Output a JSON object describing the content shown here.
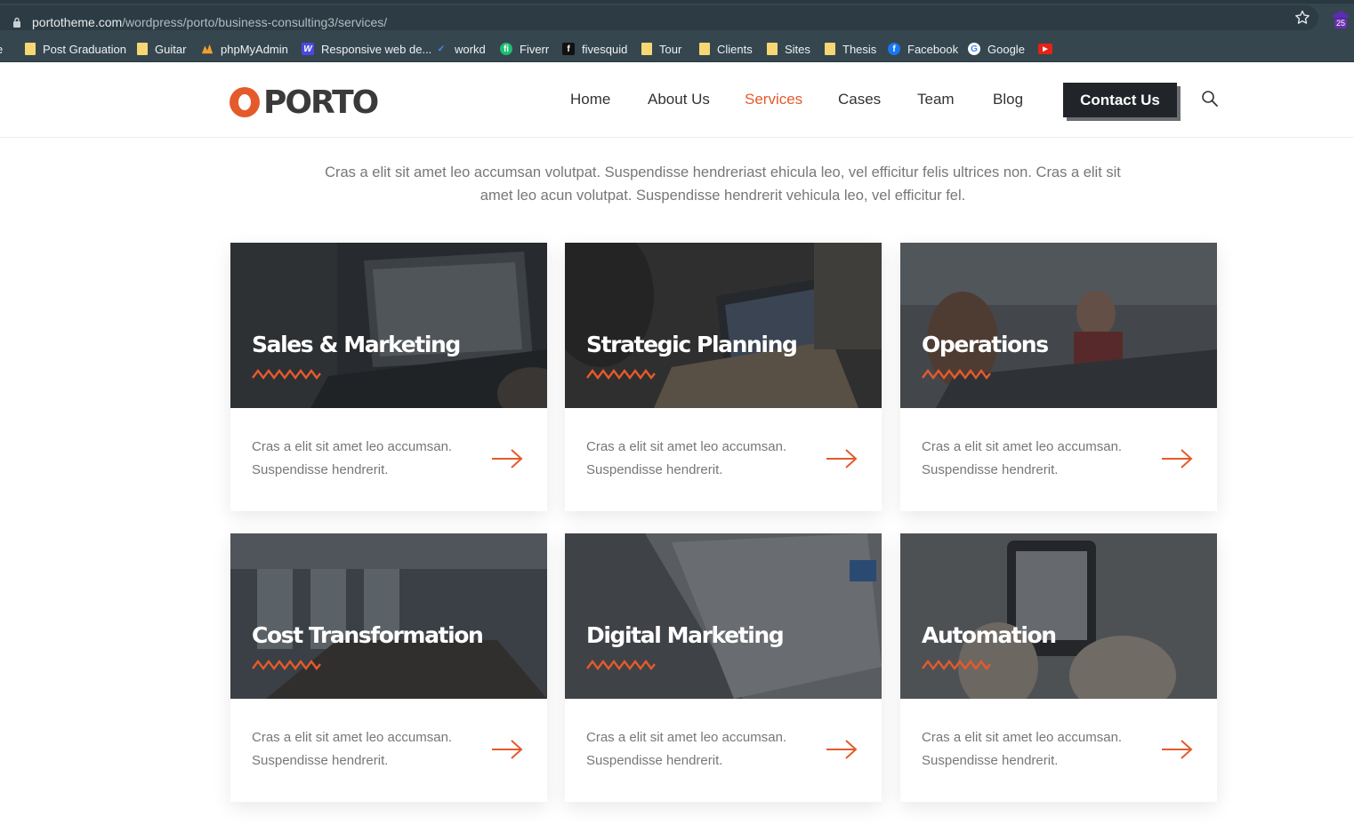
{
  "browser": {
    "url_host": "portotheme.com",
    "url_path": "/wordpress/porto/business-consulting3/services/",
    "extension_badge": "25",
    "bookmarks": [
      {
        "label": "Post Graduation",
        "icon": "folder-icon"
      },
      {
        "label": "Guitar",
        "icon": "folder-icon"
      },
      {
        "label": "phpMyAdmin",
        "icon": "phpmyadmin-icon"
      },
      {
        "label": "Responsive web de...",
        "icon": "w-icon"
      },
      {
        "label": "workd",
        "icon": "workd-icon"
      },
      {
        "label": "Fiverr",
        "icon": "fiverr-icon"
      },
      {
        "label": "fivesquid",
        "icon": "fivesquid-icon"
      },
      {
        "label": "Tour",
        "icon": "folder-icon"
      },
      {
        "label": "Clients",
        "icon": "folder-icon"
      },
      {
        "label": "Sites",
        "icon": "folder-icon"
      },
      {
        "label": "Thesis",
        "icon": "folder-icon"
      },
      {
        "label": "Facebook",
        "icon": "facebook-icon"
      },
      {
        "label": "Google",
        "icon": "google-icon"
      },
      {
        "label": "",
        "icon": "youtube-icon"
      }
    ]
  },
  "header": {
    "logo_text": "PORTO",
    "nav": [
      {
        "label": "Home",
        "active": false
      },
      {
        "label": "About Us",
        "active": false
      },
      {
        "label": "Services",
        "active": true
      },
      {
        "label": "Cases",
        "active": false
      },
      {
        "label": "Team",
        "active": false
      },
      {
        "label": "Blog",
        "active": false
      }
    ],
    "contact_label": "Contact Us"
  },
  "intro_text": "Cras a elit sit amet leo accumsan volutpat. Suspendisse hendreriast ehicula leo, vel efficitur felis ultrices non. Cras a elit sit amet leo acun volutpat. Suspendisse hendrerit vehicula leo, vel efficitur fel.",
  "services": [
    {
      "title": "Sales & Marketing",
      "text": "Cras a elit sit amet leo accumsan. Suspendisse hendrerit."
    },
    {
      "title": "Strategic Planning",
      "text": "Cras a elit sit amet leo accumsan. Suspendisse hendrerit."
    },
    {
      "title": "Operations",
      "text": "Cras a elit sit amet leo accumsan. Suspendisse hendrerit."
    },
    {
      "title": "Cost Transformation",
      "text": "Cras a elit sit amet leo accumsan. Suspendisse hendrerit."
    },
    {
      "title": "Digital Marketing",
      "text": "Cras a elit sit amet leo accumsan. Suspendisse hendrerit."
    },
    {
      "title": "Automation",
      "text": "Cras a elit sit amet leo accumsan. Suspendisse hendrerit."
    }
  ],
  "colors": {
    "accent": "#e55a2b",
    "dark": "#212529",
    "chrome": "#35464f"
  }
}
